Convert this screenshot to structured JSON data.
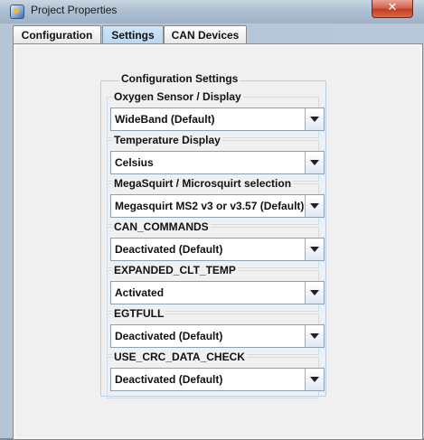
{
  "window": {
    "title": "Project Properties",
    "close_glyph": "✕"
  },
  "tabs": [
    {
      "label": "Configuration",
      "active": false
    },
    {
      "label": "Settings",
      "active": true
    },
    {
      "label": "CAN Devices",
      "active": false
    }
  ],
  "settings": {
    "group_title": "Configuration Settings",
    "fields": [
      {
        "label": "Oxygen Sensor / Display",
        "value": "WideBand (Default)"
      },
      {
        "label": "Temperature Display",
        "value": "Celsius"
      },
      {
        "label": "MegaSquirt / Microsquirt selection",
        "value": "Megasquirt MS2 v3 or v3.57 (Default)"
      },
      {
        "label": "CAN_COMMANDS",
        "value": "Deactivated (Default)"
      },
      {
        "label": "EXPANDED_CLT_TEMP",
        "value": "Activated"
      },
      {
        "label": "EGTFULL",
        "value": "Deactivated (Default)"
      },
      {
        "label": "USE_CRC_DATA_CHECK",
        "value": "Deactivated (Default)"
      }
    ]
  },
  "icons": {
    "app": "project-properties-icon",
    "dropdown": "chevron-down-icon",
    "close": "close-icon"
  }
}
